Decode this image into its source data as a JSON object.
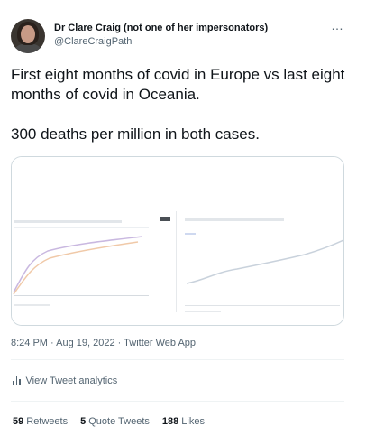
{
  "author": {
    "name": "Dr Clare Craig (not one of her impersonators)",
    "handle": "@ClareCraigPath"
  },
  "more_icon": "…",
  "tweet": {
    "line1": "First eight months of covid in Europe vs last eight months of covid in Oceania.",
    "line2": "300 deaths per million in both cases."
  },
  "timestamp": "8:24 PM · Aug 19, 2022 · Twitter Web App",
  "analytics_label": "View Tweet analytics",
  "stats": {
    "retweets_count": "59",
    "retweets_label": "Retweets",
    "quotes_count": "5",
    "quotes_label": "Quote Tweets",
    "likes_count": "188",
    "likes_label": "Likes"
  },
  "colors": {
    "text": "#0f1419",
    "secondary": "#536471",
    "border": "#cfd9de",
    "europe_line_a": "#c9b8e0",
    "europe_line_b": "#f0c9a8",
    "oceania_line": "#c9d2dc"
  }
}
